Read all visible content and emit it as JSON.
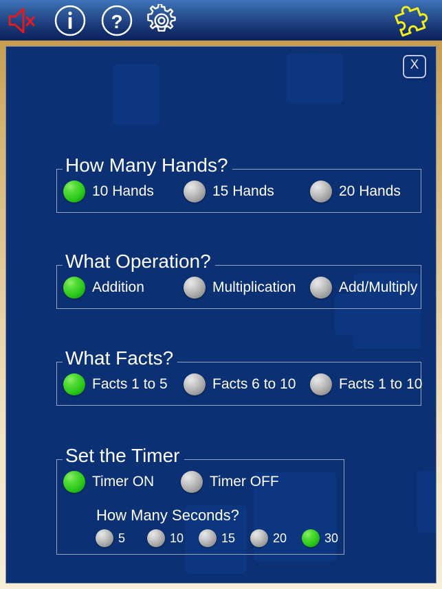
{
  "toolbar": {
    "icons": [
      {
        "name": "mute-icon",
        "label": "Sound Off"
      },
      {
        "name": "info-icon",
        "label": "Info"
      },
      {
        "name": "help-icon",
        "label": "Help"
      },
      {
        "name": "gear-icon",
        "label": "Settings"
      },
      {
        "name": "puzzle-icon",
        "label": "Puzzle"
      }
    ]
  },
  "dialog": {
    "close_label": "X",
    "colors": {
      "background": "#0b3073",
      "frame_top": "#c79c4f",
      "frame_bottom": "#f7eed8",
      "selected": "#2ec91d",
      "unselected": "#aaaaaa",
      "text": "#ffffff",
      "group_border": "#9aa3bd"
    },
    "groups": [
      {
        "id": "hands",
        "legend": "How Many Hands?",
        "options": [
          {
            "label": "10 Hands",
            "selected": true
          },
          {
            "label": "15 Hands",
            "selected": false
          },
          {
            "label": "20 Hands",
            "selected": false
          }
        ]
      },
      {
        "id": "operation",
        "legend": "What Operation?",
        "options": [
          {
            "label": "Addition",
            "selected": true
          },
          {
            "label": "Multiplication",
            "selected": false
          },
          {
            "label": "Add/Multiply",
            "selected": false
          }
        ]
      },
      {
        "id": "facts",
        "legend": "What Facts?",
        "options": [
          {
            "label": "Facts 1 to 5",
            "selected": true
          },
          {
            "label": "Facts 6 to 10",
            "selected": false
          },
          {
            "label": "Facts 1 to 10",
            "selected": false
          }
        ]
      }
    ],
    "timer": {
      "legend": "Set the Timer",
      "options": [
        {
          "label": "Timer ON",
          "selected": true
        },
        {
          "label": "Timer OFF",
          "selected": false
        }
      ],
      "seconds_label": "How Many Seconds?",
      "seconds": [
        {
          "label": "5",
          "selected": false
        },
        {
          "label": "10",
          "selected": false
        },
        {
          "label": "15",
          "selected": false
        },
        {
          "label": "20",
          "selected": false
        },
        {
          "label": "30",
          "selected": true
        }
      ]
    }
  }
}
